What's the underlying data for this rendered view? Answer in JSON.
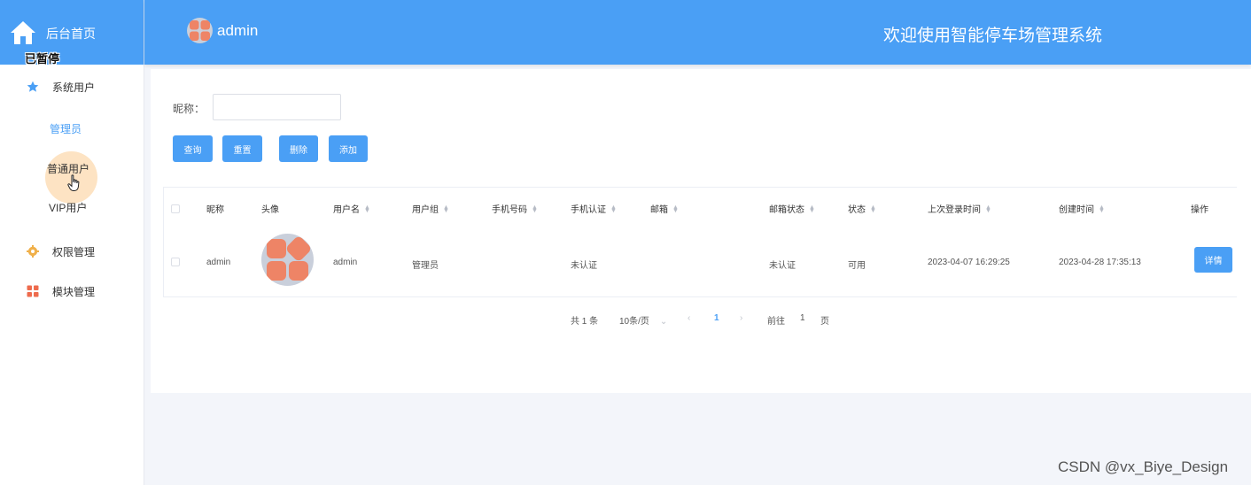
{
  "app": {
    "home_label": "后台首页",
    "paused_label": "已暂停",
    "header_user": "admin",
    "header_title": "欢迎使用智能停车场管理系统",
    "accent_color": "#4a9ff5"
  },
  "sidebar": {
    "groups": [
      {
        "label": "系统用户",
        "icon": "star-icon"
      },
      {
        "label": "权限管理",
        "icon": "gear-icon"
      },
      {
        "label": "模块管理",
        "icon": "grid-icon"
      }
    ],
    "subitems": [
      {
        "label": "管理员",
        "active": true
      },
      {
        "label": "普通用户",
        "active": false
      },
      {
        "label": "VIP用户",
        "active": false
      }
    ]
  },
  "search": {
    "label": "昵称：",
    "value": "",
    "placeholder": ""
  },
  "buttons": {
    "query": "查询",
    "reset": "重置",
    "delete": "删除",
    "add": "添加"
  },
  "table": {
    "columns": [
      {
        "label": "昵称",
        "sortable": false
      },
      {
        "label": "头像",
        "sortable": false
      },
      {
        "label": "用户名",
        "sortable": true
      },
      {
        "label": "用户组",
        "sortable": true
      },
      {
        "label": "手机号码",
        "sortable": true
      },
      {
        "label": "手机认证",
        "sortable": true
      },
      {
        "label": "邮箱",
        "sortable": true
      },
      {
        "label": "邮箱状态",
        "sortable": true
      },
      {
        "label": "状态",
        "sortable": true
      },
      {
        "label": "上次登录时间",
        "sortable": true
      },
      {
        "label": "创建时间",
        "sortable": true
      },
      {
        "label": "操作",
        "sortable": false
      }
    ],
    "rows": [
      {
        "nickname": "admin",
        "username": "admin",
        "group": "管理员",
        "phone": "",
        "phone_verified": "未认证",
        "email": "",
        "email_status": "未认证",
        "status": "可用",
        "last_login": "2023-04-07 16:29:25",
        "created": "2023-04-28 17:35:13",
        "action": "详情"
      }
    ]
  },
  "pagination": {
    "total": "共 1 条",
    "page_size": "10条/页",
    "current": "1",
    "goto_prefix": "前往",
    "goto_value": "1",
    "goto_suffix": "页"
  },
  "watermark": "CSDN @vx_Biye_Design"
}
